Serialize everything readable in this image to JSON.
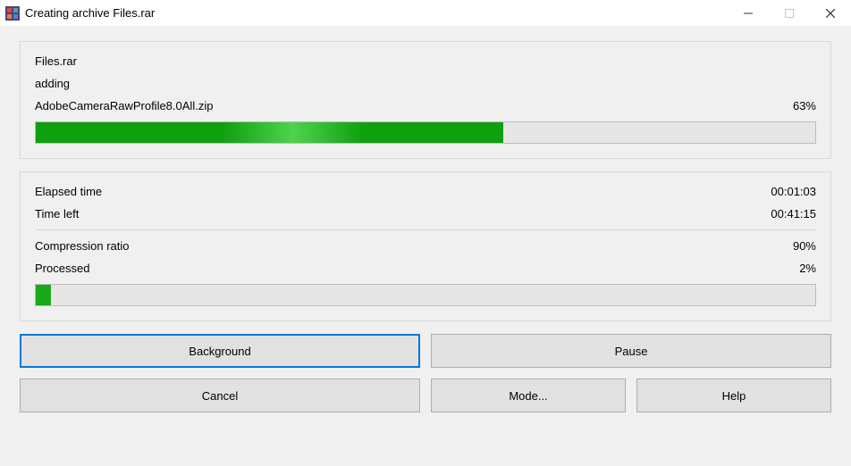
{
  "window": {
    "title": "Creating archive Files.rar"
  },
  "file": {
    "archive_name": "Files.rar",
    "status_label": "adding",
    "current_file": "AdobeCameraRawProfile8.0All.zip",
    "file_percent": "63%",
    "file_progress_width": "60%"
  },
  "stats": {
    "elapsed_label": "Elapsed time",
    "elapsed_value": "00:01:03",
    "timeleft_label": "Time left",
    "timeleft_value": "00:41:15",
    "ratio_label": "Compression ratio",
    "ratio_value": "90%",
    "processed_label": "Processed",
    "processed_value": "2%",
    "total_progress_width": "2%"
  },
  "buttons": {
    "background": "Background",
    "pause": "Pause",
    "cancel": "Cancel",
    "mode": "Mode...",
    "help": "Help"
  }
}
